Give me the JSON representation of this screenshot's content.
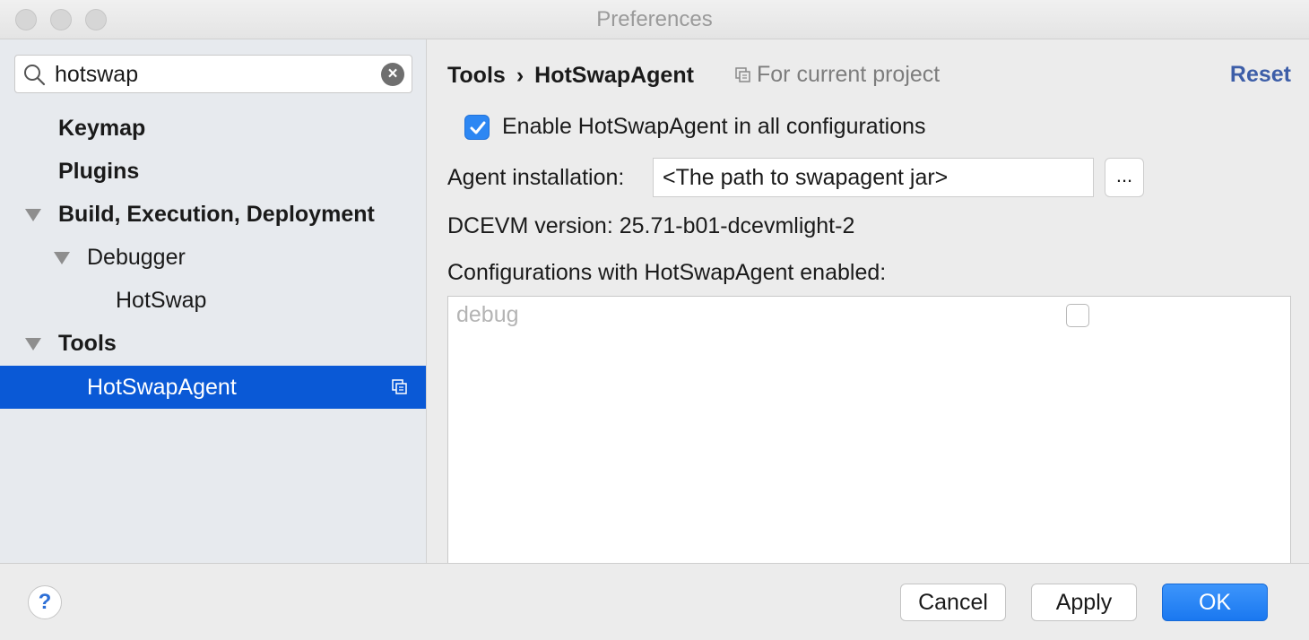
{
  "window": {
    "title": "Preferences"
  },
  "search": {
    "value": "hotswap",
    "placeholder": ""
  },
  "sidebar": {
    "items": [
      {
        "label": "Keymap"
      },
      {
        "label": "Plugins"
      },
      {
        "label": "Build, Execution, Deployment"
      },
      {
        "label": "Debugger"
      },
      {
        "label": "HotSwap"
      },
      {
        "label": "Tools"
      },
      {
        "label": "HotSwapAgent"
      }
    ]
  },
  "header": {
    "breadcrumb": [
      "Tools",
      "HotSwapAgent"
    ],
    "breadcrumb_separator": "›",
    "scope": "For current project",
    "reset": "Reset"
  },
  "settings": {
    "enable_label": "Enable HotSwapAgent in all configurations",
    "enable_checked": true,
    "agent_label": "Agent installation:",
    "agent_value": "<The path to swapagent jar>",
    "browse_label": "...",
    "dcevm_version": "DCEVM version: 25.71-b01-dcevmlight-2",
    "configs_label": "Configurations with HotSwapAgent enabled:",
    "configs": [
      {
        "name": "debug",
        "enabled": false
      }
    ]
  },
  "footer": {
    "help": "?",
    "cancel": "Cancel",
    "apply": "Apply",
    "ok": "OK"
  },
  "colors": {
    "selection": "#0a59d6",
    "accent_link": "#3d5ea8",
    "checkbox": "#2d87f3",
    "ok_button": "#1a78f0"
  }
}
